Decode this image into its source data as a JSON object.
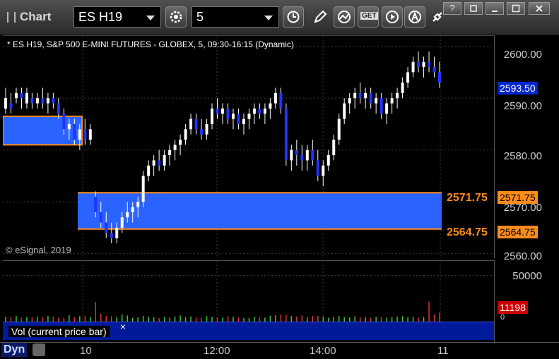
{
  "window": {
    "title": "Chart",
    "symbol": "ES H19",
    "interval": "5",
    "buttons": [
      "help",
      "restore",
      "maximize",
      "close"
    ],
    "help_label": "?"
  },
  "toolbar": {
    "tools": [
      "clock-icon",
      "pencil-icon",
      "study-icon",
      "get-icon",
      "play-icon",
      "alert-icon",
      "link-icon"
    ],
    "get_label": "GET"
  },
  "chart": {
    "header": "* ES H19, S&P 500 E-MINI FUTURES - GLOBEX, 5, 09:30-16:15 (Dynamic)",
    "copyright": "© eSignal, 2019",
    "price_axis": [
      "2600.00",
      "2590.00",
      "2580.00",
      "2570.00",
      "2560.00"
    ],
    "last_price": "2593.50",
    "levels": [
      {
        "label": "2571.75",
        "tag": "2571.75"
      },
      {
        "label": "2564.75",
        "tag": "2564.75"
      }
    ],
    "level_color": "#ff8c1a",
    "zone_color": "#2a63ff"
  },
  "volume": {
    "legend": "Vol (current price bar)",
    "close_label": "×",
    "axis_label": "50000",
    "current": "11198",
    "zero_label": "0"
  },
  "time_axis": [
    "10",
    "12:00",
    "14:00",
    "11"
  ],
  "footer": {
    "mode": "Dyn"
  },
  "chart_data": {
    "type": "candlestick",
    "ylim": [
      2559,
      2602
    ],
    "candles": [
      [
        2588,
        2592,
        2587,
        2590
      ],
      [
        2589,
        2591,
        2587,
        2588
      ],
      [
        2590,
        2592,
        2589,
        2591
      ],
      [
        2591,
        2592,
        2588,
        2590
      ],
      [
        2589,
        2592,
        2588,
        2591
      ],
      [
        2590,
        2591,
        2588,
        2589
      ],
      [
        2589,
        2591,
        2588,
        2590
      ],
      [
        2590,
        2592,
        2588,
        2589
      ],
      [
        2589,
        2591,
        2587,
        2590
      ],
      [
        2590,
        2591,
        2588,
        2589
      ],
      [
        2589,
        2590,
        2586,
        2587
      ],
      [
        2587,
        2588,
        2583,
        2584
      ],
      [
        2584,
        2586,
        2582,
        2585
      ],
      [
        2585,
        2586,
        2581,
        2582
      ],
      [
        2582,
        2585,
        2580,
        2584
      ],
      [
        2584,
        2586,
        2581,
        2582
      ],
      [
        2582,
        2585,
        2581,
        2584
      ],
      [
        2571,
        2572,
        2567,
        2568
      ],
      [
        2568,
        2570,
        2565,
        2566
      ],
      [
        2566,
        2568,
        2563,
        2564
      ],
      [
        2564,
        2566,
        2562,
        2563
      ],
      [
        2563,
        2566,
        2562,
        2565
      ],
      [
        2565,
        2568,
        2564,
        2567
      ],
      [
        2567,
        2570,
        2566,
        2568
      ],
      [
        2568,
        2570,
        2566,
        2569
      ],
      [
        2569,
        2571,
        2567,
        2570
      ],
      [
        2570,
        2576,
        2569,
        2575
      ],
      [
        2575,
        2578,
        2574,
        2577
      ],
      [
        2577,
        2579,
        2575,
        2578
      ],
      [
        2578,
        2580,
        2576,
        2577
      ],
      [
        2577,
        2580,
        2576,
        2579
      ],
      [
        2579,
        2581,
        2577,
        2580
      ],
      [
        2580,
        2582,
        2578,
        2581
      ],
      [
        2581,
        2583,
        2579,
        2582
      ],
      [
        2582,
        2585,
        2581,
        2584
      ],
      [
        2584,
        2587,
        2583,
        2586
      ],
      [
        2586,
        2587,
        2583,
        2584
      ],
      [
        2584,
        2586,
        2582,
        2583
      ],
      [
        2583,
        2586,
        2582,
        2585
      ],
      [
        2585,
        2589,
        2584,
        2588
      ],
      [
        2588,
        2590,
        2586,
        2587
      ],
      [
        2587,
        2589,
        2585,
        2588
      ],
      [
        2588,
        2589,
        2585,
        2586
      ],
      [
        2586,
        2588,
        2584,
        2587
      ],
      [
        2587,
        2588,
        2584,
        2585
      ],
      [
        2585,
        2587,
        2583,
        2586
      ],
      [
        2586,
        2588,
        2584,
        2587
      ],
      [
        2587,
        2589,
        2585,
        2588
      ],
      [
        2588,
        2589,
        2586,
        2587
      ],
      [
        2587,
        2589,
        2585,
        2588
      ],
      [
        2588,
        2590,
        2586,
        2589
      ],
      [
        2589,
        2592,
        2588,
        2591
      ],
      [
        2591,
        2592,
        2587,
        2588
      ],
      [
        2588,
        2589,
        2577,
        2578
      ],
      [
        2578,
        2581,
        2576,
        2580
      ],
      [
        2580,
        2582,
        2577,
        2579
      ],
      [
        2579,
        2581,
        2576,
        2578
      ],
      [
        2578,
        2581,
        2576,
        2580
      ],
      [
        2580,
        2582,
        2577,
        2578
      ],
      [
        2578,
        2580,
        2574,
        2575
      ],
      [
        2575,
        2578,
        2573,
        2577
      ],
      [
        2577,
        2580,
        2576,
        2579
      ],
      [
        2579,
        2583,
        2578,
        2582
      ],
      [
        2582,
        2587,
        2581,
        2586
      ],
      [
        2586,
        2590,
        2585,
        2589
      ],
      [
        2589,
        2591,
        2587,
        2590
      ],
      [
        2590,
        2592,
        2588,
        2591
      ],
      [
        2591,
        2593,
        2589,
        2590
      ],
      [
        2590,
        2592,
        2588,
        2591
      ],
      [
        2591,
        2592,
        2588,
        2589
      ],
      [
        2589,
        2591,
        2587,
        2590
      ],
      [
        2590,
        2591,
        2586,
        2587
      ],
      [
        2587,
        2590,
        2585,
        2589
      ],
      [
        2589,
        2591,
        2587,
        2590
      ],
      [
        2590,
        2592,
        2588,
        2591
      ],
      [
        2591,
        2594,
        2590,
        2593
      ],
      [
        2593,
        2596,
        2592,
        2595
      ],
      [
        2595,
        2598,
        2594,
        2597
      ],
      [
        2597,
        2599,
        2595,
        2596
      ],
      [
        2596,
        2598,
        2594,
        2597
      ],
      [
        2597,
        2599,
        2595,
        2596
      ],
      [
        2596,
        2598,
        2594,
        2595
      ],
      [
        2595,
        2597,
        2592,
        2593
      ]
    ],
    "volumes": [
      6200,
      5800,
      7100,
      5400,
      6000,
      5600,
      6300,
      5900,
      7200,
      6500,
      5300,
      4900,
      8100,
      5600,
      6900,
      7400,
      6000,
      23000,
      9800,
      7100,
      6800,
      6300,
      8900,
      7700,
      5100,
      5800,
      7200,
      6400,
      5600,
      4700,
      6100,
      5300,
      6700,
      7800,
      5900,
      6600,
      5200,
      4800,
      7000,
      6100,
      5700,
      5400,
      6900,
      6300,
      5800,
      5100,
      4900,
      6200,
      5600,
      5300,
      7300,
      8100,
      9000,
      8400,
      7100,
      6500,
      7600,
      5800,
      6900,
      7200,
      6600,
      5200,
      5900,
      7100,
      6000,
      5500,
      6800,
      6200,
      5700,
      5100,
      6400,
      5900,
      5300,
      6100,
      6600,
      7000,
      5800,
      6300,
      5400,
      6000,
      23500,
      9000,
      11198
    ],
    "candle_up_color": "#ffffff",
    "candle_down_color": "#2233ff",
    "vol_up_color": "#3cc43c",
    "vol_down_color": "#e03030"
  }
}
